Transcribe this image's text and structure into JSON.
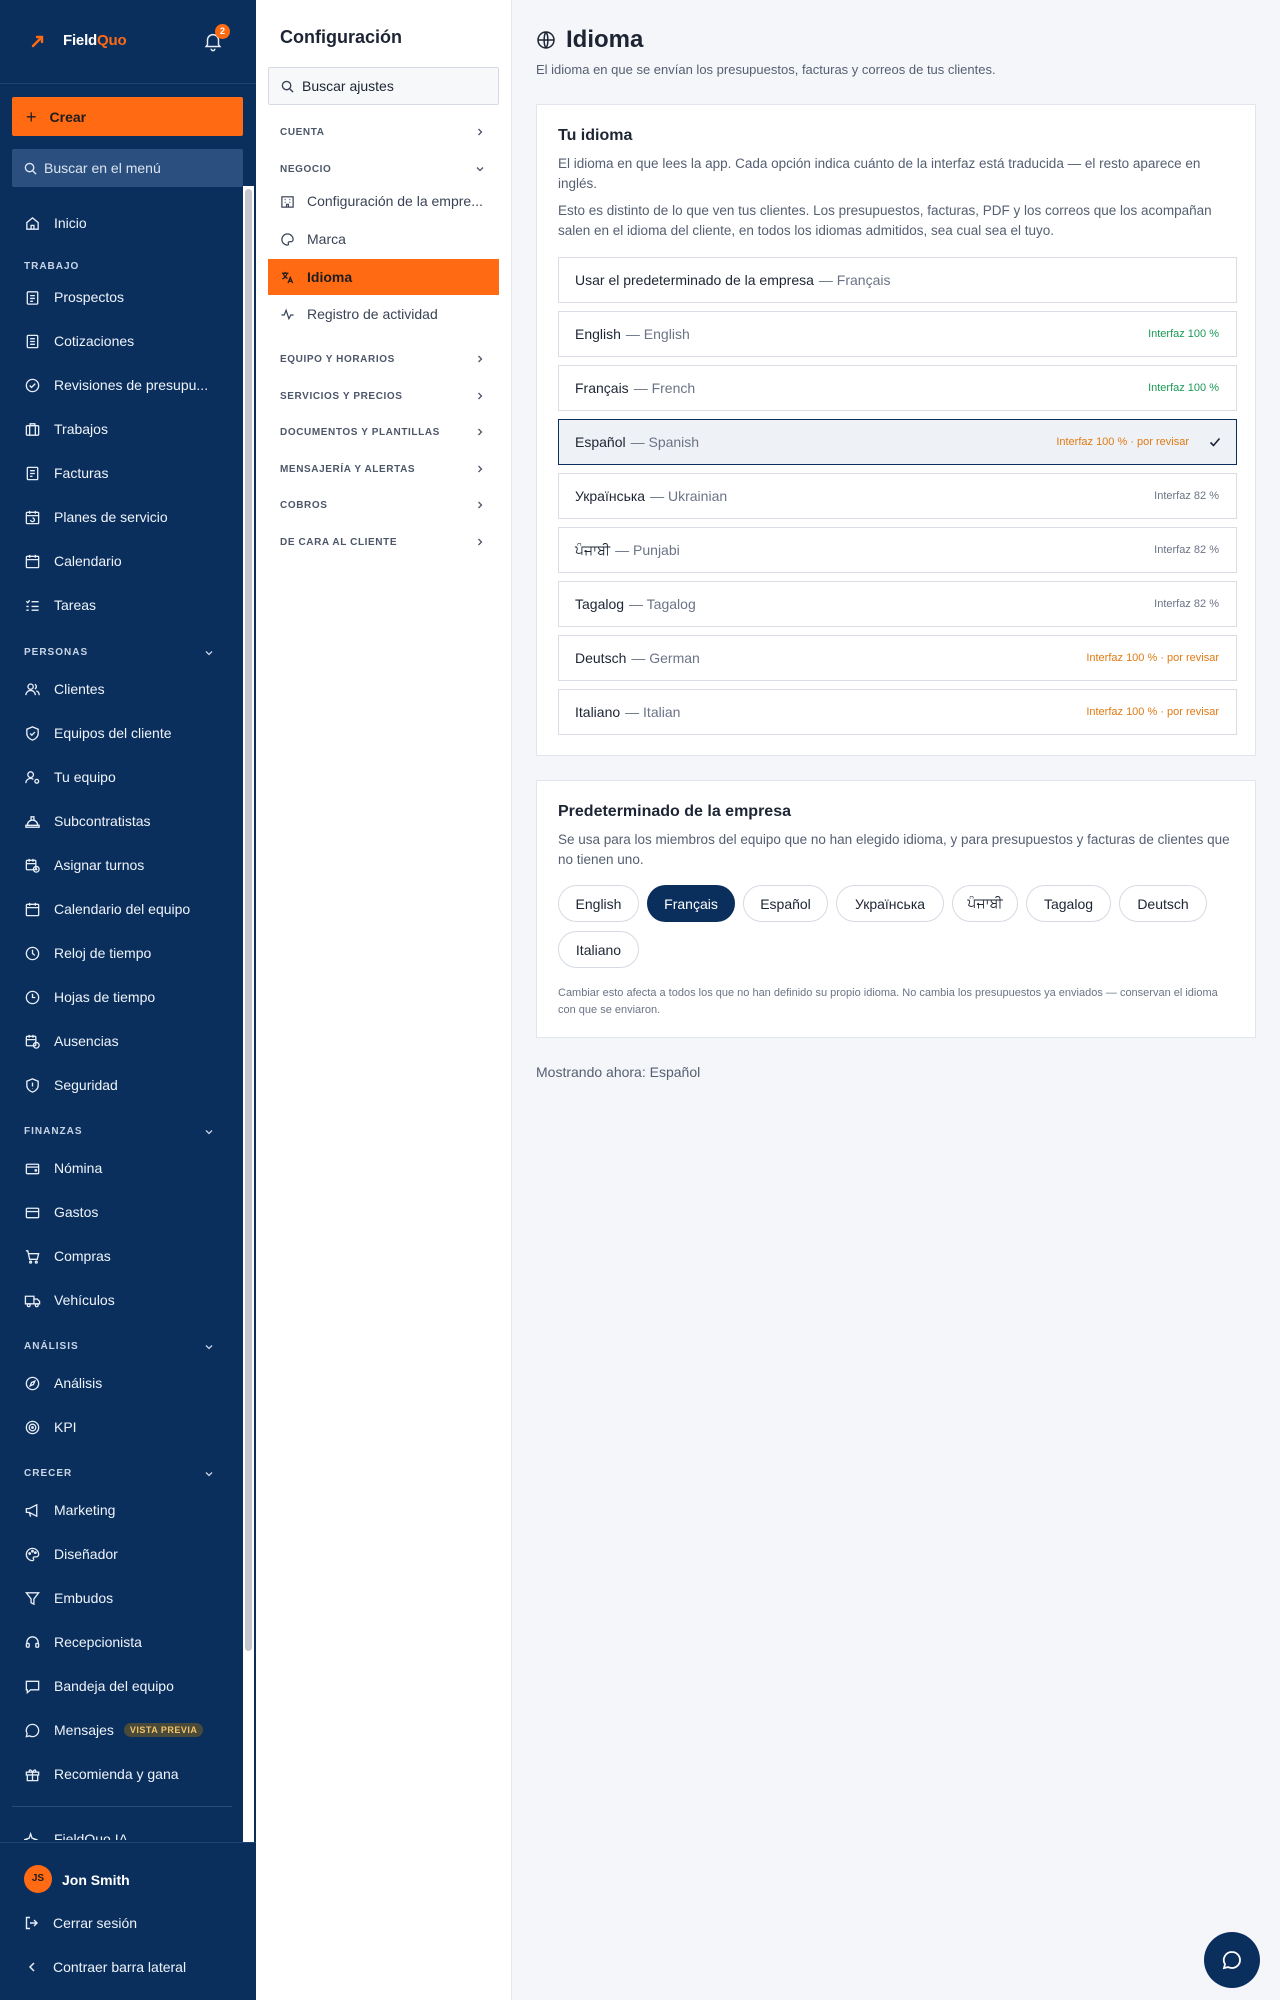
{
  "brand": {
    "name_a": "Field",
    "name_b": "Quo",
    "notifications": "2"
  },
  "sidebar": {
    "create_label": "Crear",
    "search_placeholder": "Buscar en el menú",
    "home": "Inicio",
    "sections": {
      "trabajo": "TRABAJO",
      "personas": "PERSONAS",
      "finanzas": "FINANZAS",
      "analisis": "ANÁLISIS",
      "crecer": "CRECER"
    },
    "trabajo_items": [
      "Prospectos",
      "Cotizaciones",
      "Revisiones de presupu...",
      "Trabajos",
      "Facturas",
      "Planes de servicio",
      "Calendario",
      "Tareas"
    ],
    "personas_items": [
      "Clientes",
      "Equipos del cliente",
      "Tu equipo",
      "Subcontratistas",
      "Asignar turnos",
      "Calendario del equipo",
      "Reloj de tiempo",
      "Hojas de tiempo",
      "Ausencias",
      "Seguridad"
    ],
    "finanzas_items": [
      "Nómina",
      "Gastos",
      "Compras",
      "Vehículos"
    ],
    "analisis_items": [
      "Análisis",
      "KPI"
    ],
    "crecer_items": [
      "Marketing",
      "Diseñador",
      "Embudos",
      "Recepcionista",
      "Bandeja del equipo",
      "Mensajes",
      "Recomienda y gana"
    ],
    "preview_badge": "VISTA PREVIA",
    "ai_item": "FieldQuo IA",
    "user": {
      "initials": "JS",
      "name": "Jon Smith"
    },
    "logout": "Cerrar sesión",
    "collapse": "Contraer barra lateral"
  },
  "settings": {
    "title": "Configuración",
    "search_placeholder": "Buscar ajustes",
    "groups": {
      "cuenta": "CUENTA",
      "negocio": "NEGOCIO",
      "equipo": "EQUIPO Y HORARIOS",
      "servicios": "SERVICIOS Y PRECIOS",
      "documentos": "DOCUMENTOS Y PLANTILLAS",
      "mensajeria": "MENSAJERÍA Y ALERTAS",
      "cobros": "COBROS",
      "cliente": "DE CARA AL CLIENTE"
    },
    "negocio_items": [
      "Configuración de la empre...",
      "Marca",
      "Idioma",
      "Registro de actividad"
    ]
  },
  "page": {
    "title": "Idioma",
    "subtitle": "El idioma en que se envían los presupuestos, facturas y correos de tus clientes."
  },
  "your_language": {
    "title": "Tu idioma",
    "p1": "El idioma en que lees la app. Cada opción indica cuánto de la interfaz está traducida — el resto aparece en inglés.",
    "p2": "Esto es distinto de lo que ven tus clientes. Los presupuestos, facturas, PDF y los correos que los acompañan salen en el idioma del cliente, en todos los idiomas admitidos, sea cual sea el tuyo.",
    "default_option": {
      "label": "Usar el predeterminado de la empresa",
      "value": "— Français"
    },
    "options": [
      {
        "native": "English",
        "english": "— English",
        "status": "Interfaz 100 %",
        "tone": "green"
      },
      {
        "native": "Français",
        "english": "— French",
        "status": "Interfaz 100 %",
        "tone": "green"
      },
      {
        "native": "Español",
        "english": "— Spanish",
        "status": "Interfaz 100 % · por revisar",
        "tone": "orange"
      },
      {
        "native": "Українська",
        "english": "— Ukrainian",
        "status": "Interfaz 82 %",
        "tone": "gray"
      },
      {
        "native": "ਪੰਜਾਬੀ",
        "english": "— Punjabi",
        "status": "Interfaz 82 %",
        "tone": "gray"
      },
      {
        "native": "Tagalog",
        "english": "— Tagalog",
        "status": "Interfaz 82 %",
        "tone": "gray"
      },
      {
        "native": "Deutsch",
        "english": "— German",
        "status": "Interfaz 100 % · por revisar",
        "tone": "orange"
      },
      {
        "native": "Italiano",
        "english": "— Italian",
        "status": "Interfaz 100 % · por revisar",
        "tone": "orange"
      }
    ],
    "selected": "Español"
  },
  "company_default": {
    "title": "Predeterminado de la empresa",
    "p": "Se usa para los miembros del equipo que no han elegido idioma, y para presupuestos y facturas de clientes que no tienen uno.",
    "pills": [
      "English",
      "Français",
      "Español",
      "Українська",
      "ਪੰਜਾਬੀ",
      "Tagalog",
      "Deutsch",
      "Italiano"
    ],
    "selected": "Français",
    "note": "Cambiar esto afecta a todos los que no han definido su propio idioma. No cambia los presupuestos ya enviados — conservan el idioma con que se enviaron."
  },
  "showing_now": "Mostrando ahora: Español",
  "colors": {
    "navy": "#0b2f5c",
    "accent": "#ff6a13",
    "green": "#1a9a55",
    "orange": "#e07a14"
  }
}
